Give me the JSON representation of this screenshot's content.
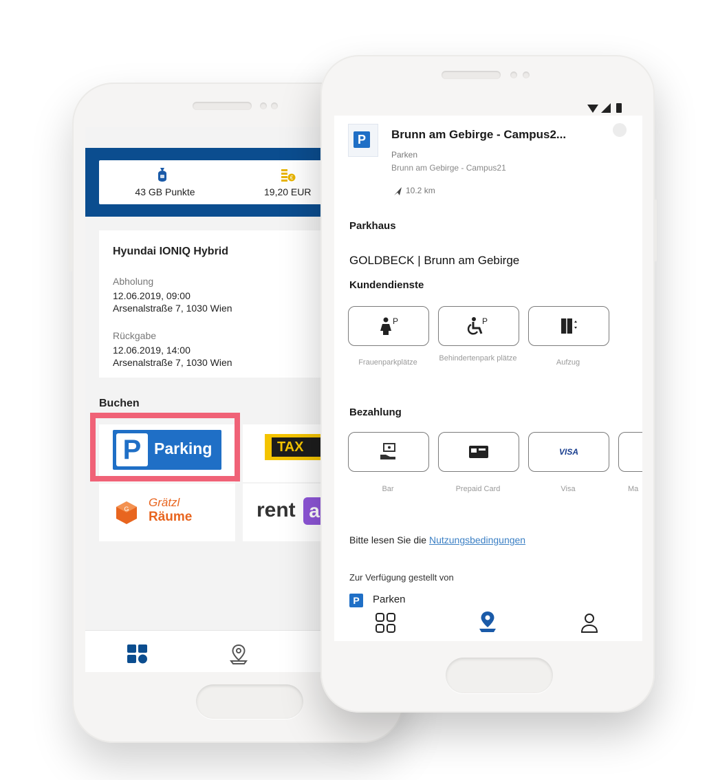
{
  "back": {
    "points": {
      "label": "43 GB Punkte"
    },
    "money": {
      "label": "19,20 EUR"
    },
    "car": {
      "title": "Hyundai IONIQ Hybrid",
      "pickup_label": "Abholung",
      "pickup_datetime": "12.06.2019, 09:00",
      "pickup_address": "Arsenalstraße 7, 1030 Wien",
      "return_label": "Rückgabe",
      "return_datetime": "12.06.2019, 14:00",
      "return_address": "Arsenalstraße 7, 1030 Wien"
    },
    "book_heading": "Buchen",
    "tiles": {
      "parking_letter": "P",
      "parking_label": "Parking",
      "taxi_label": "TAX",
      "graetzl_top": "Grätzl",
      "graetzl_bottom": "Räume",
      "rent_label": "rent",
      "rent_badge": "a"
    },
    "highlight_color": "#f06277"
  },
  "front": {
    "place": {
      "icon_letter": "P",
      "title": "Brunn am Gebirge - Campus2...",
      "category": "Parken",
      "subtitle": "Brunn am Gebirge - Campus21",
      "distance": "10.2 km"
    },
    "type_heading": "Parkhaus",
    "operator": "GOLDBECK | Brunn am Gebirge",
    "services_heading": "Kundendienste",
    "services": [
      {
        "caption": "Frauenparkplätze",
        "icon": "female-parking-icon"
      },
      {
        "caption": "Behindertenpark plätze",
        "icon": "disabled-parking-icon"
      },
      {
        "caption": "Aufzug",
        "icon": "elevator-icon"
      }
    ],
    "payment_heading": "Bezahlung",
    "payments": [
      {
        "caption": "Bar",
        "icon": "cash-icon"
      },
      {
        "caption": "Prepaid Card",
        "icon": "prepaid-card-icon"
      },
      {
        "caption": "Visa",
        "label": "VISA",
        "icon": "visa-icon"
      },
      {
        "caption": "Ma",
        "icon": "mastercard-icon"
      }
    ],
    "terms_prefix": "Bitte lesen Sie die ",
    "terms_link": "Nutzungsbedingungen",
    "provided_by": "Zur Verfügung gestellt von",
    "provider_letter": "P",
    "provider_name": "Parken"
  },
  "colors": {
    "brand_blue": "#0b4d8f",
    "icon_blue": "#1a5aa8",
    "parking_blue": "#1f6fc6",
    "taxi_yellow": "#f4c400",
    "graetzl_orange": "#e8651f",
    "rent_purple": "#8e56d8",
    "link_blue": "#3a7fc4"
  }
}
